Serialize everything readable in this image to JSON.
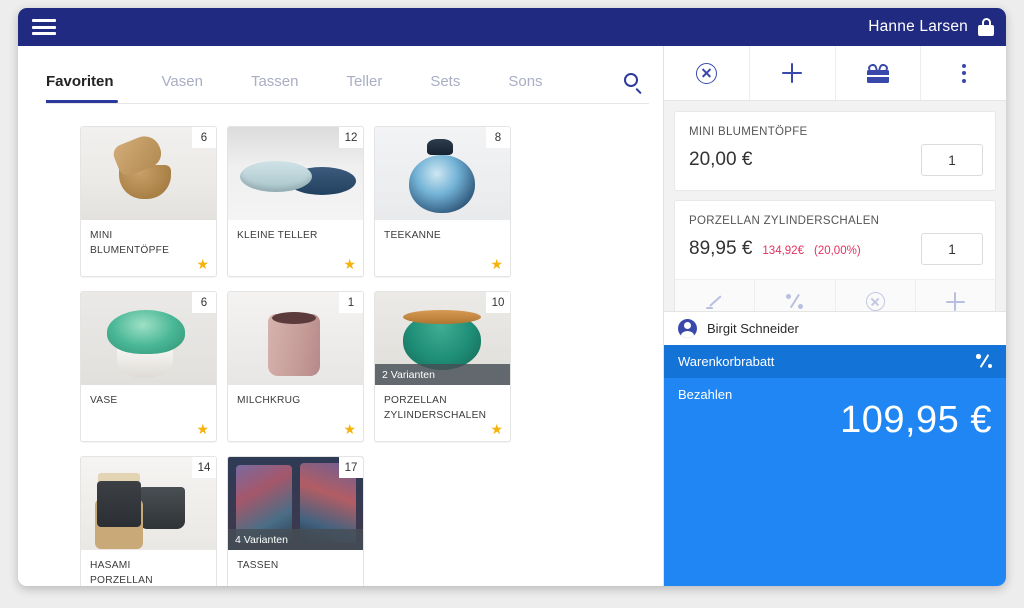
{
  "topbar": {
    "menu_icon": "hamburger-icon",
    "user_name": "Hanne Larsen",
    "lock_icon": "lock-icon"
  },
  "catalog": {
    "tabs": [
      {
        "label": "Favoriten",
        "active": true
      },
      {
        "label": "Vasen",
        "active": false
      },
      {
        "label": "Tassen",
        "active": false
      },
      {
        "label": "Teller",
        "active": false
      },
      {
        "label": "Sets",
        "active": false
      },
      {
        "label": "Sons",
        "active": false
      }
    ],
    "search_icon": "search-icon",
    "products": [
      {
        "name": "MINI BLUMENTÖPFE",
        "stock": "6",
        "variants": "",
        "favorite": "★"
      },
      {
        "name": "KLEINE TELLER",
        "stock": "12",
        "variants": "",
        "favorite": "★"
      },
      {
        "name": "TEEKANNE",
        "stock": "8",
        "variants": "",
        "favorite": "★"
      },
      {
        "name": "VASE",
        "stock": "6",
        "variants": "",
        "favorite": "★"
      },
      {
        "name": "MILCHKRUG",
        "stock": "1",
        "variants": "",
        "favorite": "★"
      },
      {
        "name": "PORZELLAN ZYLINDERSCHALEN",
        "stock": "10",
        "variants": "2 Varianten",
        "favorite": "★"
      },
      {
        "name": "HASAMI PORZELLAN ZUCKERTOPF",
        "stock": "14",
        "variants": "",
        "favorite": "★"
      },
      {
        "name": "TASSEN",
        "stock": "17",
        "variants": "4 Varianten",
        "favorite": "★"
      }
    ]
  },
  "cart": {
    "toolbar": [
      {
        "icon": "cancel-circle-icon",
        "label": "Abbrechen"
      },
      {
        "icon": "plus-icon",
        "label": "Hinzufügen"
      },
      {
        "icon": "gift-icon",
        "label": "Gutschein"
      },
      {
        "icon": "more-vertical-icon",
        "label": "Mehr"
      }
    ],
    "items": [
      {
        "name": "MINI BLUMENTÖPFE",
        "price": "20,00 €",
        "original_price": "",
        "discount": "",
        "quantity": "1",
        "selected": false
      },
      {
        "name": "PORZELLAN ZYLINDERSCHALEN",
        "price": "89,95 €",
        "original_price": "134,92€",
        "discount": "(20,00%)",
        "quantity": "1",
        "selected": true,
        "actions": [
          {
            "icon": "edit-pencil-icon",
            "label": "Bearbeiten"
          },
          {
            "icon": "percent-icon",
            "label": "Rabatt"
          },
          {
            "icon": "remove-circle-icon",
            "label": "Entfernen"
          },
          {
            "icon": "plus-icon",
            "label": "Hinzufügen"
          }
        ]
      }
    ],
    "customer": {
      "avatar_icon": "person-icon",
      "name": "Birgit Schneider"
    },
    "discount_row": {
      "label": "Warenkorbrabatt",
      "icon": "percent-icon"
    },
    "pay_row": {
      "label": "Bezahlen",
      "total": "109,95 €"
    }
  },
  "colors": {
    "topbar": "#1f2a80",
    "accent_indigo": "#3949ab",
    "tab_underline": "#2b3a9c",
    "discount_blue": "#1473d6",
    "pay_blue": "#1f86f3",
    "strike_red": "#e53060",
    "star_gold": "#f5b30b"
  }
}
